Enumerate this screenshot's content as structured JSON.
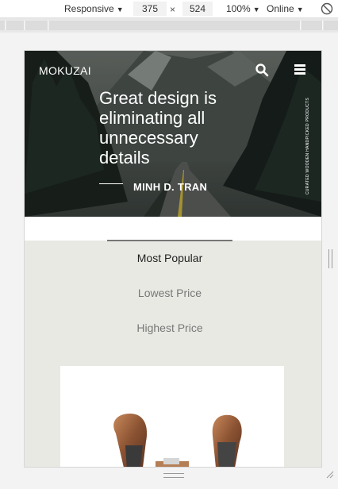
{
  "devtools": {
    "device": "Responsive",
    "width": "375",
    "times": "×",
    "height": "524",
    "zoom": "100%",
    "network": "Online"
  },
  "site": {
    "brand": "MOKUZAI",
    "headline": "Great design is eliminating all unnecessary details",
    "author": "MINH D. TRAN",
    "vertical_tag": "CURATED WOODEN HANDPICKED PRODUCTS",
    "sort_options": [
      "Most Popular",
      "Lowest Price",
      "Highest Price"
    ],
    "active_sort": "Most Popular"
  }
}
